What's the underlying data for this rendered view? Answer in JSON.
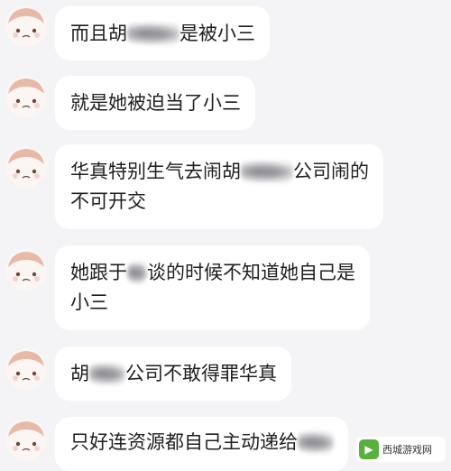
{
  "messages": [
    {
      "parts": [
        "而且胡",
        "",
        "是被小三"
      ]
    },
    {
      "parts": [
        "就是她被迫当了小三"
      ]
    },
    {
      "parts": [
        "华真特别生气去闹胡",
        "",
        "公司闹的",
        "不可开交"
      ]
    },
    {
      "parts": [
        "她跟于",
        "",
        "谈的时候不知道她自己是",
        "小三"
      ]
    },
    {
      "parts": [
        "胡",
        "",
        "公司不敢得罪华真"
      ]
    },
    {
      "parts": [
        "只好连资源都自己主动递给",
        ""
      ]
    }
  ],
  "watermark": {
    "text": "西城游戏网",
    "icon": "game-logo-icon"
  },
  "colors": {
    "bubble": "#ffffff",
    "background": "#f4f4f6",
    "text": "#1f1f1f",
    "avatar_face": "#fbf6f4"
  }
}
